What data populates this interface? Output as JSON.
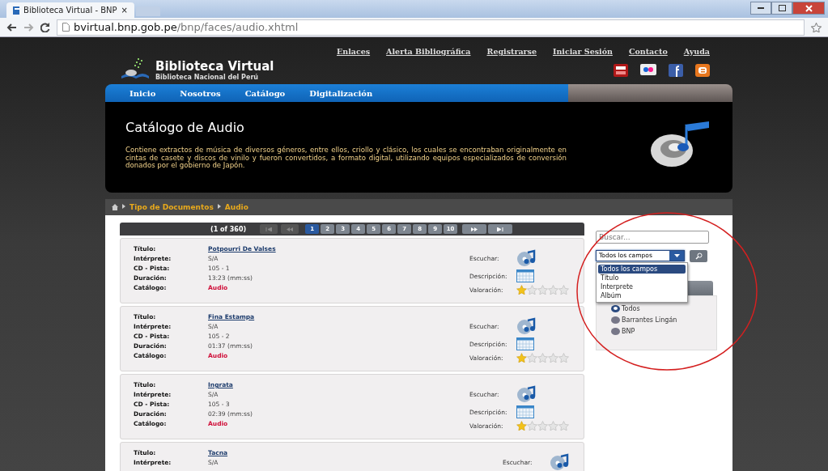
{
  "browser": {
    "tab_title": "Biblioteca Virtual - BNP",
    "tab_close": "×",
    "url_host": "bvirtual.bnp.gob.pe",
    "url_path": "/bnp/faces/audio.xhtml"
  },
  "header": {
    "title": "Biblioteca Virtual",
    "subtitle": "Biblioteca Nacional del Perú",
    "links": [
      "Enlaces",
      "Alerta Bibliográfica",
      "Registrarse",
      "Iniciar Sesión",
      "Contacto",
      "Ayuda"
    ]
  },
  "nav": [
    "Inicio",
    "Nosotros",
    "Catálogo",
    "Digitalización"
  ],
  "banner": {
    "title": "Catálogo de Audio",
    "description": "Contiene extractos de música de diversos géneros, entre ellos, criollo y clásico, los cuales se encontraban originalmente en cintas de casete y discos de vinilo y fueron convertidos, a formato digital, utilizando equipos especializados de conversión donados por el gobierno de Japón."
  },
  "breadcrumb": [
    "Tipo de Documentos",
    "Audio"
  ],
  "paginator": {
    "summary": "(1 of 360)",
    "pages": [
      {
        "label": "1",
        "selected": true
      },
      {
        "label": "2",
        "selected": false
      },
      {
        "label": "3",
        "selected": false
      },
      {
        "label": "4",
        "selected": false
      },
      {
        "label": "5",
        "selected": false
      },
      {
        "label": "6",
        "selected": false
      },
      {
        "label": "7",
        "selected": false
      },
      {
        "label": "8",
        "selected": false
      },
      {
        "label": "9",
        "selected": false
      },
      {
        "label": "10",
        "selected": false
      }
    ]
  },
  "records": [
    {
      "fields": [
        {
          "label": "Título:",
          "value": "Potpourri De Valses",
          "kind": "link"
        },
        {
          "label": "Intérprete:",
          "value": "S/A",
          "kind": "text"
        },
        {
          "label": "CD - Pista:",
          "value": "105 - 1",
          "kind": "text"
        },
        {
          "label": "Duración:",
          "value": "13:23 (mm:ss)",
          "kind": "text"
        },
        {
          "label": "Catálogo:",
          "value": "Audio",
          "kind": "catalog"
        }
      ],
      "actions": [
        {
          "label": "Escuchar:",
          "kind": "listen"
        },
        {
          "label": "Descripción:",
          "kind": "description"
        },
        {
          "label": "Valoración:",
          "kind": "rating"
        }
      ],
      "stars": 1
    },
    {
      "fields": [
        {
          "label": "Título:",
          "value": "Fina Estampa",
          "kind": "link"
        },
        {
          "label": "Intérprete:",
          "value": "S/A",
          "kind": "text"
        },
        {
          "label": "CD - Pista:",
          "value": "105 - 2",
          "kind": "text"
        },
        {
          "label": "Duración:",
          "value": "01:37 (mm:ss)",
          "kind": "text"
        },
        {
          "label": "Catálogo:",
          "value": "Audio",
          "kind": "catalog"
        }
      ],
      "actions": [
        {
          "label": "Escuchar:",
          "kind": "listen"
        },
        {
          "label": "Descripción:",
          "kind": "description"
        },
        {
          "label": "Valoración:",
          "kind": "rating"
        }
      ],
      "stars": 1
    },
    {
      "fields": [
        {
          "label": "Título:",
          "value": "Ingrata",
          "kind": "link"
        },
        {
          "label": "Intérprete:",
          "value": "S/A",
          "kind": "text"
        },
        {
          "label": "CD - Pista:",
          "value": "105 - 3",
          "kind": "text"
        },
        {
          "label": "Duración:",
          "value": "02:39 (mm:ss)",
          "kind": "text"
        },
        {
          "label": "Catálogo:",
          "value": "Audio",
          "kind": "catalog"
        }
      ],
      "actions": [
        {
          "label": "Escuchar:",
          "kind": "listen"
        },
        {
          "label": "Descripción:",
          "kind": "description"
        },
        {
          "label": "Valoración:",
          "kind": "rating"
        }
      ],
      "stars": 1
    },
    {
      "fields": [
        {
          "label": "Título:",
          "value": "Tacna",
          "kind": "link"
        },
        {
          "label": "Intérprete:",
          "value": "S/A",
          "kind": "text"
        }
      ],
      "actions": [
        {
          "label": "Escuchar:",
          "kind": "listen"
        }
      ]
    }
  ],
  "sidebar": {
    "search": {
      "placeholder": "Buscar..."
    },
    "field_select": {
      "value": "Todos los campos",
      "expanded": true,
      "options": [
        {
          "label": "Todos los campos",
          "selected": true
        },
        {
          "label": "Título",
          "selected": false
        },
        {
          "label": "Interprete",
          "selected": false
        },
        {
          "label": "Albúm",
          "selected": false
        }
      ]
    },
    "sources": [
      {
        "label": "Todos",
        "selected": true
      },
      {
        "label": "Barrantes Lingán",
        "selected": false
      },
      {
        "label": "BNP",
        "selected": false
      }
    ]
  }
}
